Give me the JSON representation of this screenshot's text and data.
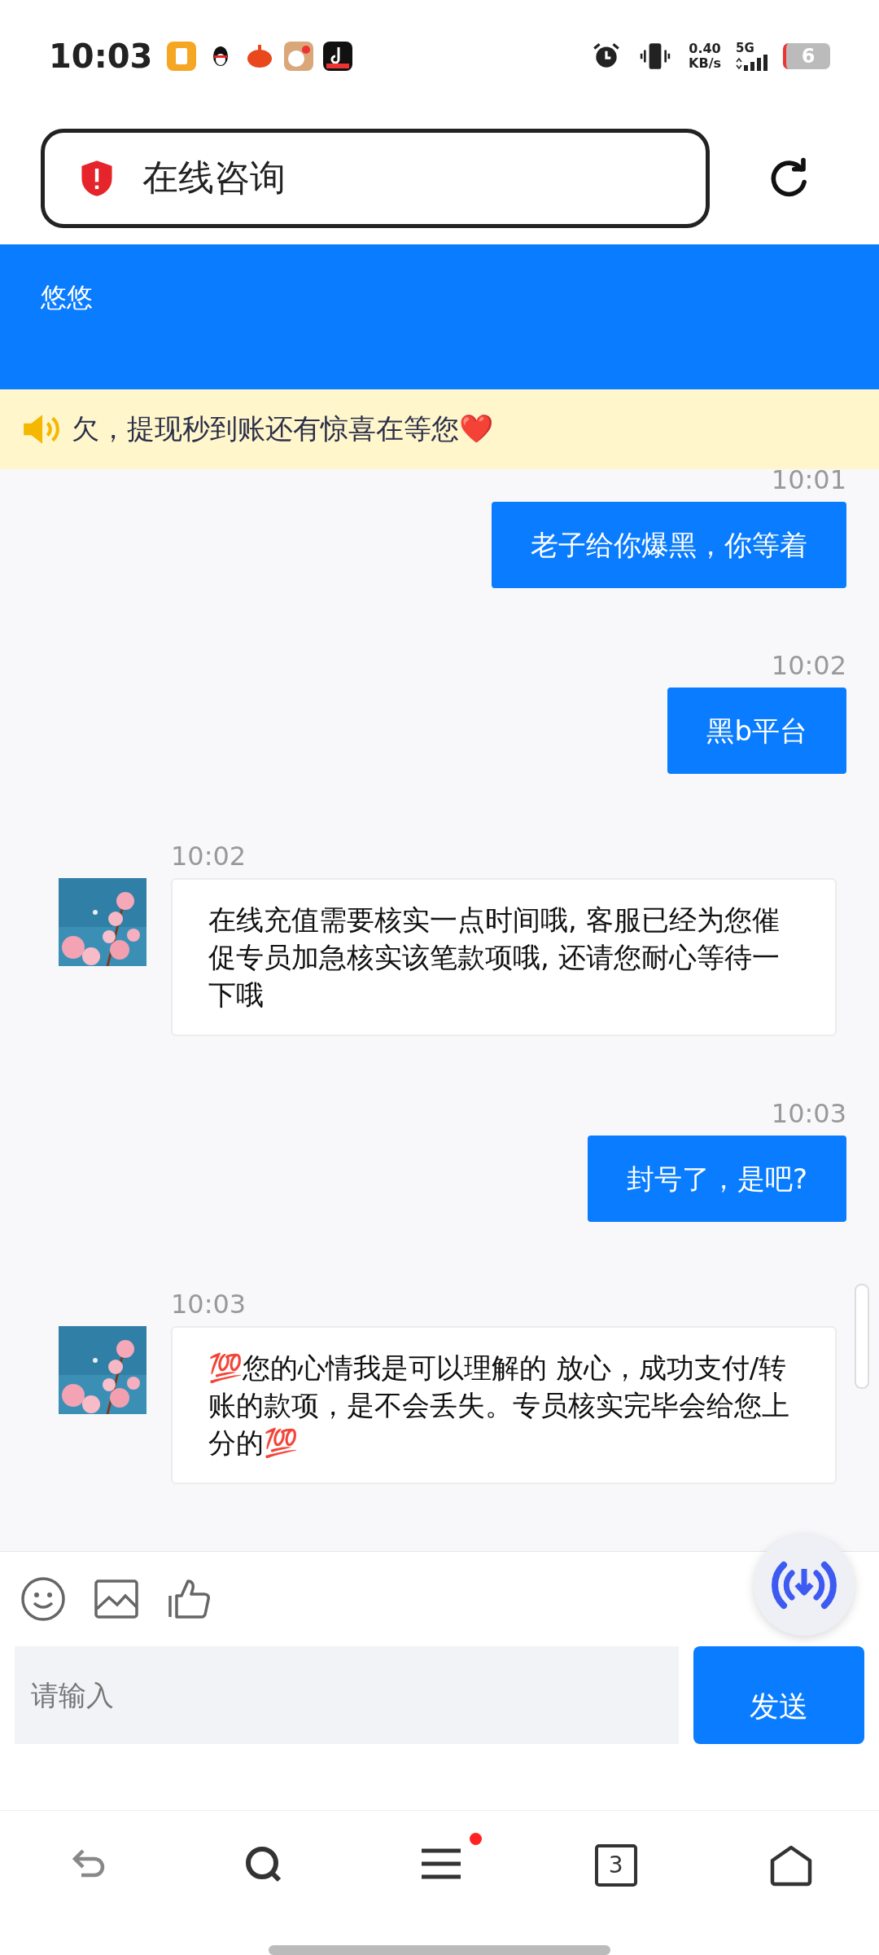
{
  "status_bar": {
    "time": "10:03",
    "speed_value": "0.40",
    "speed_unit": "KB/s",
    "network": "5G",
    "battery": "6"
  },
  "address_bar": {
    "title": "在线咨询"
  },
  "header": {
    "title": "悠悠"
  },
  "notice": {
    "text": "欠，提现秒到账还有惊喜在等您❤️"
  },
  "messages": [
    {
      "kind": "outgoing",
      "time": "10:01",
      "text": "老子给你爆黑，你等着"
    },
    {
      "kind": "outgoing",
      "time": "10:02",
      "text": "黑b平台"
    },
    {
      "kind": "incoming",
      "time": "10:02",
      "text": "在线充值需要核实一点时间哦, 客服已经为您催促专员加急核实该笔款项哦, 还请您耐心等待一下哦"
    },
    {
      "kind": "outgoing",
      "time": "10:03",
      "text": "封号了，是吧?"
    },
    {
      "kind": "incoming",
      "time": "10:03",
      "text": "💯您的心情我是可以理解的 放心，成功支付/转账的款项，是不会丢失。专员核实完毕会给您上分的💯"
    }
  ],
  "composer": {
    "placeholder": "请输入",
    "send": "发送"
  },
  "bottom_nav": {
    "tab_count": "3",
    "menu_badge": true
  }
}
